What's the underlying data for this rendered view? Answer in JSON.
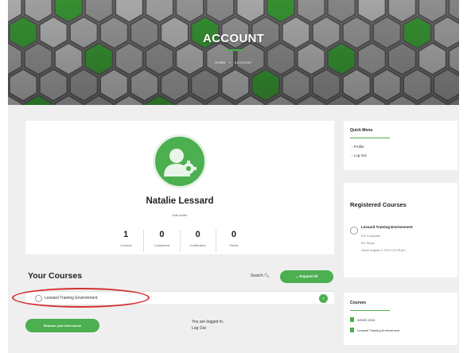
{
  "hero": {
    "title": "ACCOUNT",
    "breadcrumb_home": "HOME",
    "breadcrumb_sep": "»",
    "breadcrumb_current": "ACCOUNT"
  },
  "profile": {
    "name": "Natalie Lessard",
    "edit_label": "Edit profile",
    "stats": [
      {
        "value": "1",
        "label": "Courses"
      },
      {
        "value": "0",
        "label": "Completed"
      },
      {
        "value": "0",
        "label": "Certificates"
      },
      {
        "value": "0",
        "label": "Points"
      }
    ]
  },
  "your_courses": {
    "title": "Your Courses",
    "search_label": "Search",
    "expand_label": "Expand All",
    "expand_icon": "chevron-down-icon",
    "items": [
      {
        "label": "Lessard Training Environment"
      }
    ],
    "resume_label": "Resume your last course",
    "logged_in_text": "You are logged in.",
    "logout_label": "Log Out"
  },
  "sidebar": {
    "quick_menu": {
      "title": "Quick Menu",
      "items": [
        "Profile",
        "Log Out"
      ]
    },
    "registered": {
      "title": "Registered Courses",
      "course_title": "Lessard Training Environment",
      "progress_text": "0% Complete",
      "steps_text": "0/1 Steps",
      "since_text": "Since August 2, 2019 12:09 pm"
    },
    "courses": {
      "title": "Courses",
      "items": [
        "WHHS 2015",
        "Lessard Training Environment"
      ]
    }
  },
  "colors": {
    "accent": "#4caf50",
    "annotation": "#d32f2f",
    "content_bg": "#efefef"
  }
}
